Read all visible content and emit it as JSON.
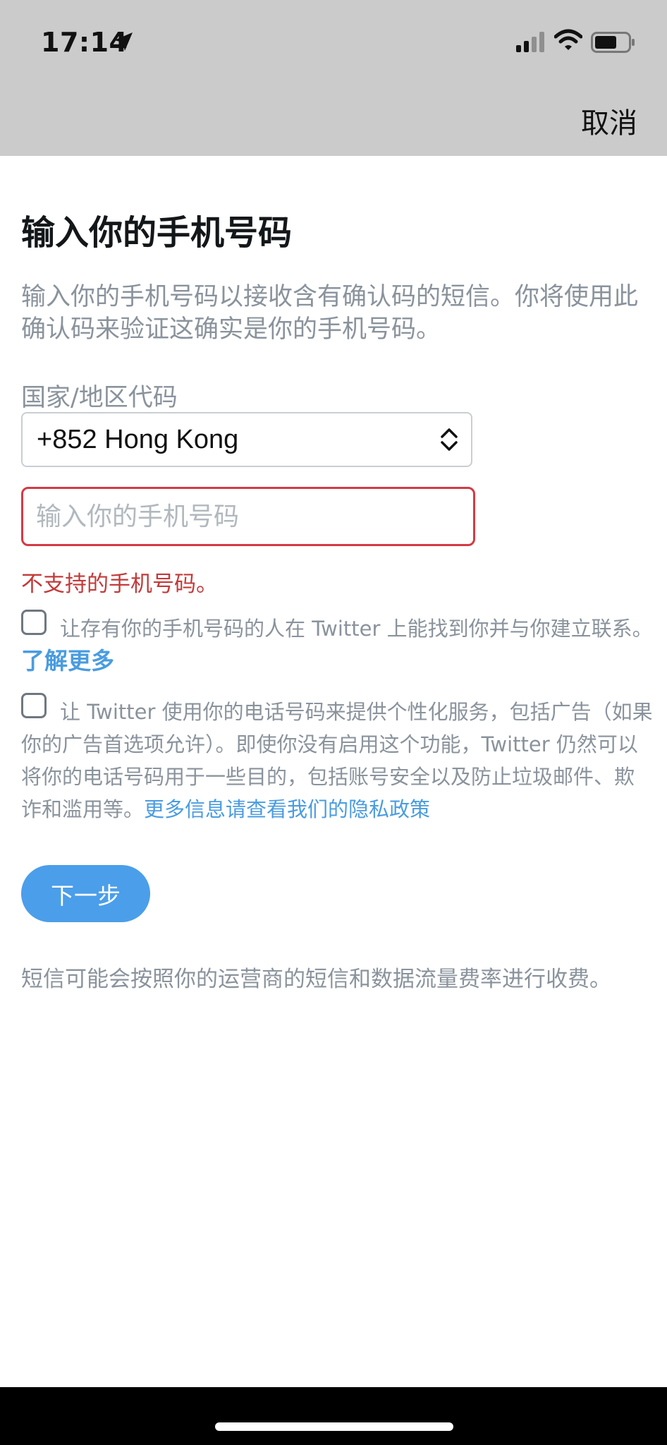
{
  "status_bar": {
    "time": "17:14"
  },
  "header": {
    "cancel_label": "取消"
  },
  "main": {
    "title": "输入你的手机号码",
    "description": "输入你的手机号码以接收含有确认码的短信。你将使用此确认码来验证这确实是你的手机号码。",
    "country_label": "国家/地区代码",
    "country_value": "+852 Hong Kong",
    "phone_placeholder": "输入你的手机号码",
    "phone_value": "",
    "error": "不支持的手机号码。",
    "consent1": "让存有你的手机号码的人在 Twitter 上能找到你并与你建立联系。",
    "learn_more": "了解更多",
    "consent2": "让 Twitter 使用你的电话号码来提供个性化服务，包括广告（如果你的广告首选项允许）。即使你没有启用这个功能，Twitter 仍然可以将你的电话号码用于一些目的，包括账号安全以及防止垃圾邮件、欺诈和滥用等。",
    "privacy_link": "更多信息请查看我们的隐私政策",
    "next_label": "下一步",
    "footnote": "短信可能会按照你的运营商的短信和数据流量费率进行收费。"
  },
  "colors": {
    "accent": "#4b9ee9",
    "error": "#d53a45",
    "header_bg": "#cbcbcb",
    "muted_text": "#8a939c"
  },
  "icons": [
    "location-arrow-icon",
    "cellular-signal-icon",
    "wifi-icon",
    "battery-icon",
    "chevron-up-down-icon"
  ]
}
